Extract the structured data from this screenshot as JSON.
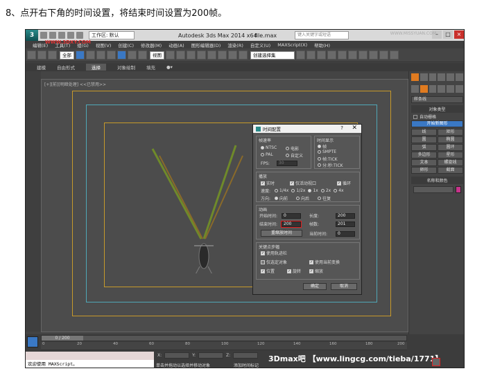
{
  "caption": "8、点开右下角的时间设置，将结束时间设置为200帧。",
  "titlebar": {
    "logo": "3",
    "workspace": "工作区: 默认",
    "app_title": "Autodesk 3ds Max  2014 x64",
    "file_title": "file.max",
    "search_placeholder": "键入关键字或短语",
    "watermark": "WWW.3DXY.COM",
    "right_watermark": "WWW.MISSYUAN.COM"
  },
  "menubar": [
    "编辑(E)",
    "工具(T)",
    "组(G)",
    "视图(V)",
    "创建(C)",
    "修改器(M)",
    "动画(A)",
    "图形编辑器(D)",
    "渲染(R)",
    "自定义(U)",
    "MAXScript(X)",
    "帮助(H)"
  ],
  "toolbar": {
    "filter_select": "全部",
    "view_select": "视图",
    "selection_set": "创建选择集"
  },
  "ribbon": [
    "建模",
    "自由形式",
    "选择",
    "对象绘制",
    "填充"
  ],
  "ribbon_active_index": 2,
  "viewport": {
    "label": "[+][前][明暗处理]  <<已禁用>>"
  },
  "command_panel": {
    "dropdown": "样条线",
    "object_type_title": "对象类型",
    "auto_grid": "自动栅格",
    "start_new_shape": "开始新图形",
    "buttons": [
      "线",
      "矩形",
      "圆",
      "椭圆",
      "弧",
      "圆环",
      "多边形",
      "星形",
      "文本",
      "螺旋线",
      "卵形",
      "截面"
    ],
    "name_color_title": "名称和颜色"
  },
  "dialog": {
    "title": "时间配置",
    "help": "?",
    "close": "✕",
    "frame_rate": {
      "title": "帧速率",
      "ntsc": "NTSC",
      "film": "电影",
      "pal": "PAL",
      "custom": "自定义",
      "fps_label": "FPS:",
      "fps_value": "30"
    },
    "time_display": {
      "title": "时间显示",
      "frames": "帧",
      "smpte": "SMPTE",
      "frame_tick": "帧:TICK",
      "min_sec_tick": "分:秒:TICK"
    },
    "playback": {
      "title": "播放",
      "realtime": "实时",
      "active_viewport_only": "仅活动视口",
      "loop": "循环",
      "speed_label": "速度:",
      "speeds": [
        "1/4x",
        "1/2x",
        "1x",
        "2x",
        "4x"
      ],
      "direction_label": "方向:",
      "directions": [
        "向前",
        "向后",
        "往复"
      ]
    },
    "animation": {
      "title": "动画",
      "start_time_label": "开始时间:",
      "start_time": "0",
      "length_label": "长度:",
      "length": "200",
      "end_time_label": "结束时间:",
      "end_time": "200",
      "frame_count_label": "帧数:",
      "frame_count": "201",
      "rescale_button": "重缩放时间",
      "current_time_label": "当前时间:",
      "current_time": "0"
    },
    "key_steps": {
      "title": "关键点步幅",
      "use_trackbar": "使用轨迹栏",
      "selected_only": "仅选定对象",
      "use_current_transform": "使用当前变换",
      "position": "位置",
      "rotation": "旋转",
      "scale": "缩放"
    },
    "ok": "确定",
    "cancel": "取消"
  },
  "timeline": {
    "slider_label": "0 / 200",
    "ticks": [
      "0",
      "20",
      "40",
      "60",
      "80",
      "100",
      "120",
      "140",
      "160",
      "180",
      "200"
    ]
  },
  "status": {
    "line1": "",
    "line2": "欢迎使用 MAXScript。",
    "prompt": "单击并拖动以选择并移动对象",
    "add_time_tag": "添加时间标记",
    "x_label": "X:",
    "y_label": "Y:",
    "z_label": "Z:",
    "watermark": "3Dmax吧 【www.lingcg.com/tieba/1771】"
  }
}
